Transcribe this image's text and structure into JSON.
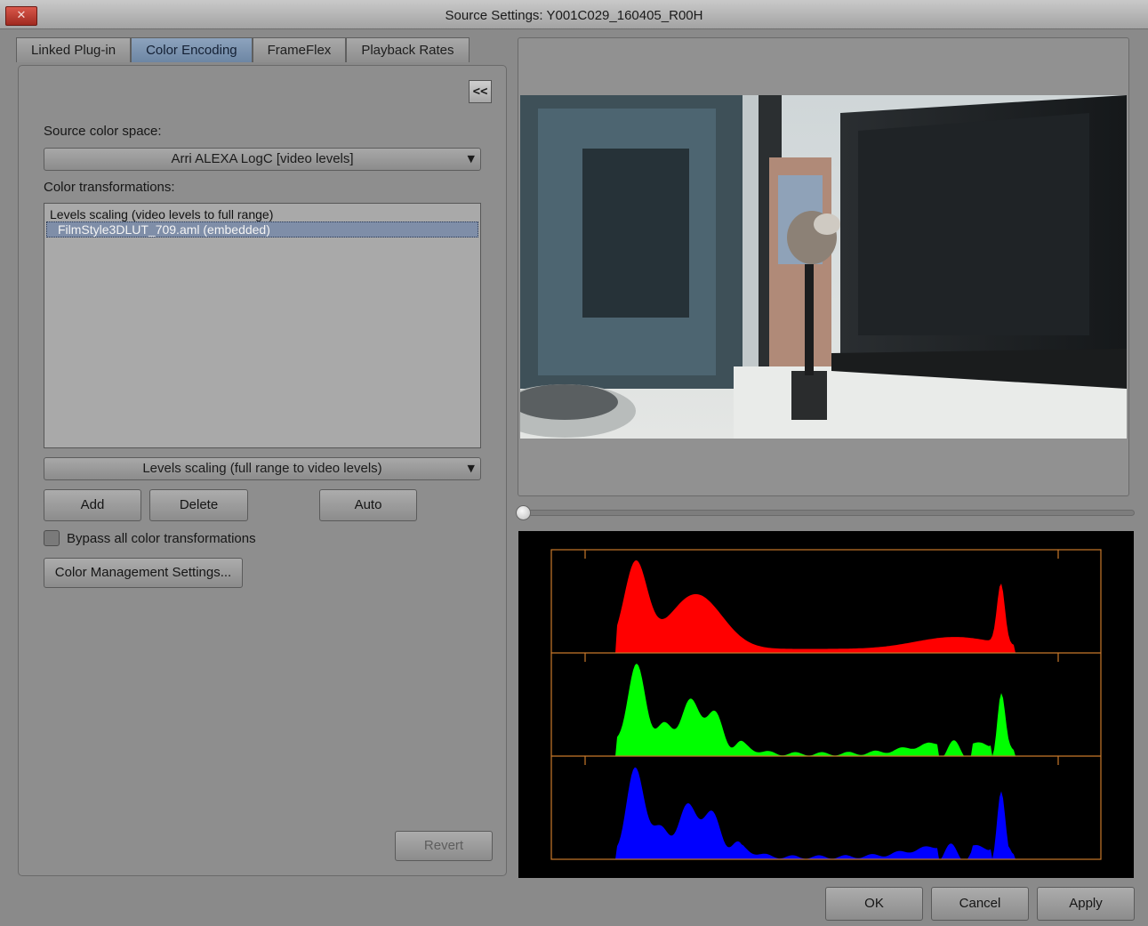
{
  "window": {
    "title": "Source Settings: Y001C029_160405_R00H",
    "close_glyph": "✕"
  },
  "tabs": [
    "Linked Plug-in",
    "Color Encoding",
    "FrameFlex",
    "Playback Rates"
  ],
  "active_tab": "Color Encoding",
  "color_encoding": {
    "collapse_label": "<<",
    "source_color_space_label": "Source color space:",
    "source_color_space_value": "Arri ALEXA LogC [video levels]",
    "transformations_label": "Color transformations:",
    "transformations": [
      {
        "label": "Levels scaling (video levels to full range)",
        "selected": false
      },
      {
        "label": "FilmStyle3DLUT_709.aml (embedded)",
        "selected": true
      }
    ],
    "transformation_picker_value": "Levels scaling (full range to video levels)",
    "add_label": "Add",
    "delete_label": "Delete",
    "auto_label": "Auto",
    "bypass_label": "Bypass all color transformations",
    "bypass_checked": false,
    "color_mgmt_label": "Color Management Settings...",
    "revert_label": "Revert"
  },
  "preview": {
    "scrub_position": 0.0
  },
  "histogram": {
    "channels": [
      "red",
      "green",
      "blue"
    ],
    "colors": {
      "red": "#ff0000",
      "green": "#00ff00",
      "blue": "#0000ff",
      "frame": "#c8782a"
    }
  },
  "footer": {
    "ok_label": "OK",
    "cancel_label": "Cancel",
    "apply_label": "Apply"
  }
}
